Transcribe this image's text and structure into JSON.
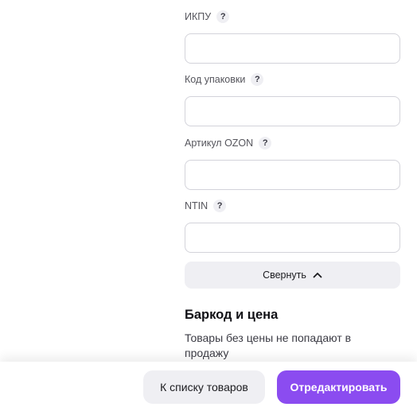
{
  "fields": [
    {
      "label": "ИКПУ",
      "help": "?",
      "value": "",
      "placeholder": ""
    },
    {
      "label": "Код упаковки",
      "help": "?",
      "value": "",
      "placeholder": ""
    },
    {
      "label": "Артикул OZON",
      "help": "?",
      "value": "",
      "placeholder": ""
    },
    {
      "label": "NTIN",
      "help": "?",
      "value": "",
      "placeholder": ""
    }
  ],
  "collapse": {
    "label": "Свернуть",
    "icon": "chevron-up-icon"
  },
  "section": {
    "title": "Баркод и цена",
    "description": "Товары без цены не попадают в продажу"
  },
  "footer": {
    "back_label": "К списку товаров",
    "edit_label": "Отредактировать"
  },
  "colors": {
    "accent": "#8b4cf0",
    "secondary_button": "#efeff3",
    "input_border": "#d3d3da"
  }
}
